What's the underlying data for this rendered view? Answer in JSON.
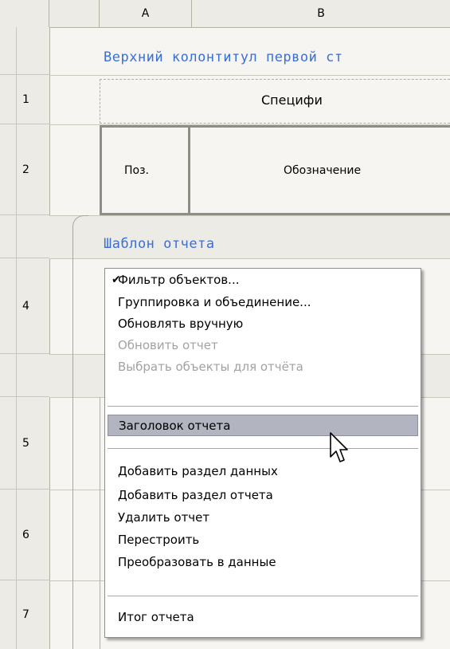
{
  "columns": {
    "a": "A",
    "b": "B"
  },
  "rows": {
    "r1": "1",
    "r2": "2",
    "r4": "4",
    "r5": "5",
    "r6": "6",
    "r7": "7"
  },
  "sections": {
    "first_page_header": "Верхний колонтитул первой ст",
    "report_template": "Шаблон отчета"
  },
  "header_text": "Специфи",
  "table": {
    "pos": "Поз.",
    "designation": "Обозначение"
  },
  "menu": {
    "filter": "Фильтр объектов...",
    "filter_checkmark": "✔",
    "grouping": "Группировка и объединение...",
    "refresh_manual": "Обновлять вручную",
    "refresh_report": "Обновить отчет",
    "select_objects": "Выбрать объекты для отчёта",
    "report_heading": "Заголовок отчета",
    "add_data_section": "Добавить раздел данных",
    "add_report_section": "Добавить раздел отчета",
    "delete_report": "Удалить отчет",
    "rebuild": "Перестроить",
    "convert_to_data": "Преобразовать в данные",
    "report_total": "Итог отчета"
  },
  "colors": {
    "mono_label": "#3a6fd6",
    "menu_highlight": "#b2b4bf",
    "disabled_text": "#a2a2a2"
  },
  "icons": {
    "check": "check-icon",
    "cursor": "arrow-cursor-icon"
  }
}
